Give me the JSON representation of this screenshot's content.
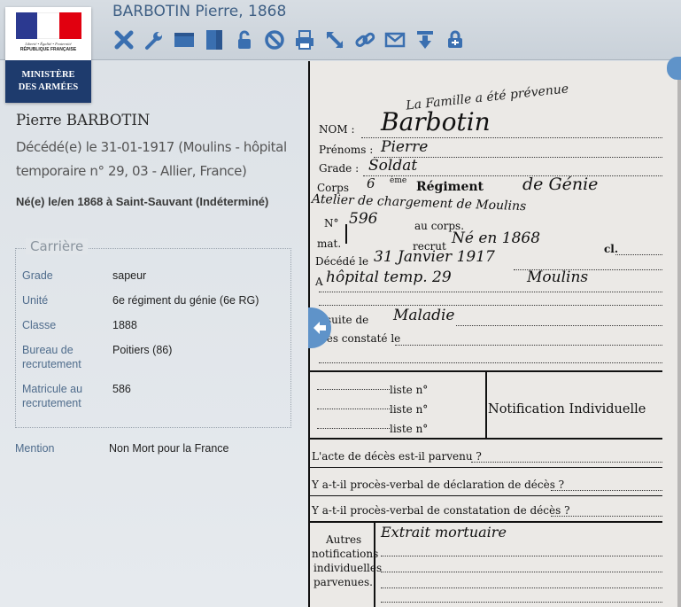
{
  "header": {
    "title": "BARBOTIN Pierre, 1868",
    "toolbar": [
      {
        "icon": "close-icon"
      },
      {
        "icon": "wrench-icon"
      },
      {
        "icon": "horizontal-layout-icon"
      },
      {
        "icon": "vertical-layout-icon"
      },
      {
        "icon": "lock-icon"
      },
      {
        "icon": "forbidden-icon"
      },
      {
        "icon": "print-icon"
      },
      {
        "icon": "expand-icon"
      },
      {
        "icon": "link-icon"
      },
      {
        "icon": "mail-icon"
      },
      {
        "icon": "download-icon"
      },
      {
        "icon": "share-icon"
      }
    ]
  },
  "logo": {
    "motto": "Liberté • Égalité • Fraternité",
    "republic": "RÉPUBLIQUE FRANÇAISE",
    "ministry_line1": "MINISTÈRE",
    "ministry_line2": "DES ARMÉES"
  },
  "person": {
    "name": "Pierre BARBOTIN",
    "death": "Décédé(e) le 31-01-1917 (Moulins - hôpital temporaire n° 29, 03 - Allier, France)",
    "birth": "Né(e) le/en 1868 à Saint-Sauvant (Indéterminé)"
  },
  "career": {
    "legend": "Carrière",
    "rows": [
      {
        "label": "Grade",
        "value": "sapeur"
      },
      {
        "label": "Unité",
        "value": "6e régiment du génie (6e RG)"
      },
      {
        "label": "Classe",
        "value": "1888"
      },
      {
        "label": "Bureau de recrutement",
        "value": "Poitiers (86)"
      },
      {
        "label": "Matricule au recrutement",
        "value": "586"
      }
    ]
  },
  "mention": {
    "label": "Mention",
    "value": "Non Mort pour la France"
  },
  "document": {
    "stamp": "La Famille a été prévenue",
    "nom_label": "NOM :",
    "nom_value": "Barbotin",
    "prenoms_label": "Prénoms :",
    "prenoms_value": "Pierre",
    "grade_label": "Grade :",
    "grade_value": "Soldat",
    "corps_label": "Corps",
    "corps_number": "6",
    "corps_ordinal": "ème",
    "corps_regiment": "Régiment",
    "corps_value": "de Génie",
    "corps_line2": "Atelier de chargement de Moulins",
    "no_label": "N°",
    "no_value": "596",
    "au_corps": "au corps.",
    "mat_label": "mat.",
    "recrut_label": "recrut",
    "recrut_value": "Né en 1868",
    "cl_label": "cl.",
    "decede_label": "Décédé le",
    "decede_value": "31 Janvier 1917",
    "hopital_label": "A",
    "hopital_value": "hôpital temp. 29",
    "moulins_value": "Moulins",
    "suite_label": "suite de",
    "suite_value": "Maladie",
    "constate_label": "cès constaté le",
    "liste1": "liste n°",
    "liste2": "liste n°",
    "liste3": "liste n°",
    "notification": "Notification Individuelle",
    "q1": "L'acte de décès est-il parvenu ?",
    "q2": "Y a-t-il procès-verbal de déclaration de décès ?",
    "q3": "Y a-t-il procès-verbal de constatation de décès ?",
    "autres1": "Autres",
    "autres2": "notifications",
    "autres3": "individuelles",
    "autres4": "parvenues.",
    "autres_value": "Extrait mortuaire"
  },
  "colors": {
    "accent": "#3e5f84",
    "icon": "#3a6fb0",
    "ministry": "#1e3b6d"
  }
}
